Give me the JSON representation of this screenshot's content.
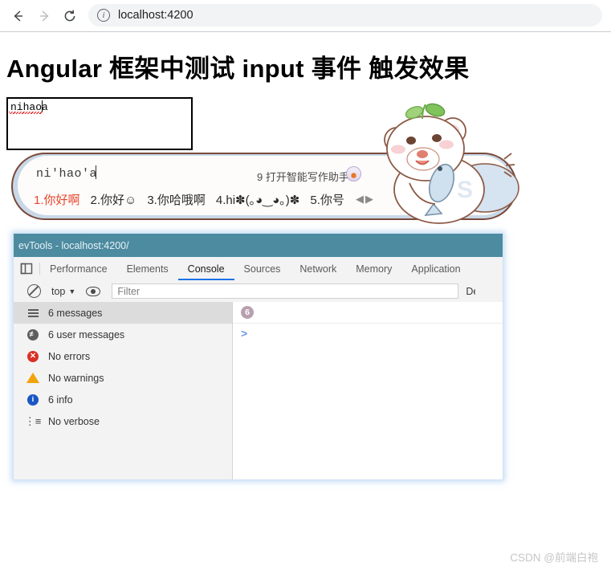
{
  "browser": {
    "back_icon": "arrow-left-icon",
    "forward_icon": "arrow-right-icon",
    "reload_icon": "reload-icon",
    "site_info_icon": "info-circle-icon",
    "url": "localhost:4200"
  },
  "page": {
    "heading": "Angular 框架中测试 input 事件 触发效果",
    "textarea_value": "nihaoa"
  },
  "ime": {
    "pinyin": "ni'hao'a",
    "assistant_label": "9 打开智能写作助手",
    "assistant_icon": "writing-assistant-icon",
    "candidates": [
      {
        "label": "1.你好啊",
        "selected": true
      },
      {
        "label": "2.你好☺",
        "selected": false
      },
      {
        "label": "3.你哈哦啊",
        "selected": false
      },
      {
        "label": "4.hi✽(｡◕‿◕｡)✽",
        "selected": false
      },
      {
        "label": "5.你号",
        "selected": false
      }
    ],
    "nav_prev_icon": "triangle-left-icon",
    "nav_next_icon": "triangle-right-icon",
    "nav_arrows": "◀▶",
    "mascot_icon": "polar-bear-mascot"
  },
  "devtools": {
    "title": "evTools - localhost:4200/",
    "dock_icon": "dock-side-icon",
    "tabs": [
      {
        "label": "Performance",
        "active": false
      },
      {
        "label": "Elements",
        "active": false
      },
      {
        "label": "Console",
        "active": true
      },
      {
        "label": "Sources",
        "active": false
      },
      {
        "label": "Network",
        "active": false
      },
      {
        "label": "Memory",
        "active": false
      },
      {
        "label": "Application",
        "active": false
      }
    ],
    "toolbar": {
      "clear_icon": "clear-console-icon",
      "context": "top",
      "context_caret": "▼",
      "eye_icon": "eye-icon",
      "filter_placeholder": "Filter",
      "levels_label": "Default levels"
    },
    "sidebar": [
      {
        "label": "6 messages",
        "icon": "hamburger-icon",
        "selected": true
      },
      {
        "label": "6 user messages",
        "icon": "user-message-icon",
        "selected": false
      },
      {
        "label": "No errors",
        "icon": "error-icon",
        "selected": false
      },
      {
        "label": "No warnings",
        "icon": "warning-icon",
        "selected": false
      },
      {
        "label": "6 info",
        "icon": "info-icon",
        "selected": false
      },
      {
        "label": "No verbose",
        "icon": "verbose-icon",
        "selected": false
      }
    ],
    "output": {
      "group_count": "6",
      "prompt_symbol": ">"
    }
  },
  "watermark": "CSDN @前端白袍",
  "colors": {
    "devtools_titlebar": "#4d8ba0",
    "active_tab_underline": "#1a73e8",
    "ime_selected_candidate": "#e8442a",
    "ime_border": "#7a4a3a",
    "error": "#d93025",
    "warning": "#f0a30a",
    "info": "#1a56c4"
  }
}
